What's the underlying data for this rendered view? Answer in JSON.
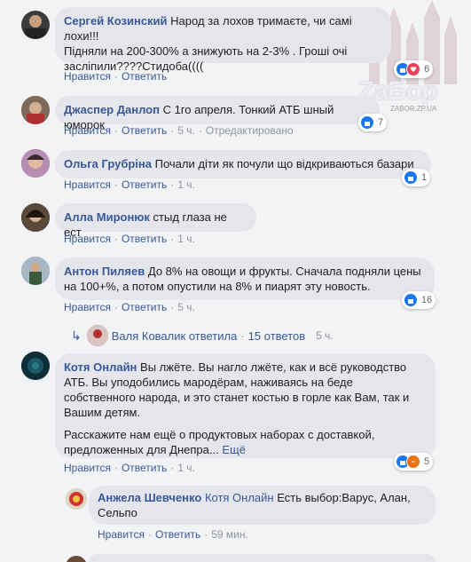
{
  "watermark": {
    "logo": "ZaБор",
    "site": "ZABOR.ZP.UA"
  },
  "actions": {
    "like": "Нравится",
    "reply": "Ответить",
    "edited": "Отредактировано",
    "more": "Ещё"
  },
  "comments": [
    {
      "author": "Сергей Козинский",
      "text_1": "Народ за лохов тримаєте, чи самі лохи!!!",
      "text_2": "Підняли на 200-300% а знижують на 2-3% . Гроші очі",
      "text_3": "засліпили????Стидоба((((",
      "time": "",
      "reactions": "6"
    },
    {
      "author": "Джаспер Данлоп",
      "text_1": "С 1го апреля. Тонкий АТБ шный юморок",
      "time": "5 ч.",
      "reactions": "7"
    },
    {
      "author": "Ольга Грубріна",
      "text_1": "Почали діти як почули що відкриваються базари",
      "time": "1 ч.",
      "reactions": "1"
    },
    {
      "author": "Алла Миронюк",
      "text_1": "стыд глаза не ест",
      "time": "1 ч."
    },
    {
      "author": "Антон Пиляев",
      "text_1": "До 8% на овощи и фрукты. Сначала подняли цены",
      "text_2": "на 100+%, а потом опустили на 8% и пиарят эту новость.",
      "time": "5 ч.",
      "reactions": "16"
    },
    {
      "author": "Котя Онлайн",
      "text_1": "Вы лжёте. Вы нагло лжёте, как и всё руководство",
      "text_2": "АТБ. Вы уподобились мародёрам, наживаясь на беде",
      "text_3": "собственного народа, и это станет костью в горле как Вам, так и",
      "text_4": "Вашим детям.",
      "text_5": "Расскажите нам ещё о продуктовых наборах с доставкой,",
      "text_6": "предложенных для Днепра...",
      "time": "1 ч.",
      "reactions": "5"
    }
  ],
  "replies_summary": {
    "author": "Валя Ковалик",
    "action": "ответила",
    "count": "15 ответов",
    "time": "5 ч."
  },
  "reply": {
    "author": "Анжела Шевченко",
    "mention": "Котя Онлайн",
    "text_1": "Есть выбор:Варус, Алан,",
    "text_2": "Сельпо",
    "time": "59 мин."
  }
}
